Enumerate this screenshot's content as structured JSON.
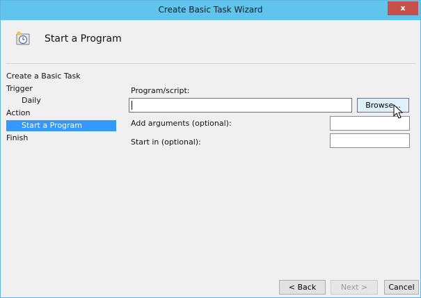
{
  "window": {
    "title": "Create Basic Task Wizard",
    "close_glyph": "x"
  },
  "header": {
    "title": "Start a Program",
    "icon": "task-scheduler-icon"
  },
  "nav": {
    "items": [
      {
        "label": "Create a Basic Task",
        "sub": false,
        "active": false
      },
      {
        "label": "Trigger",
        "sub": false,
        "active": false
      },
      {
        "label": "Daily",
        "sub": true,
        "active": false
      },
      {
        "label": "Action",
        "sub": false,
        "active": false
      },
      {
        "label": "Start a Program",
        "sub": true,
        "active": true
      },
      {
        "label": "Finish",
        "sub": false,
        "active": false
      }
    ]
  },
  "form": {
    "program_label": "Program/script:",
    "program_value": "",
    "browse_label": "Browse...",
    "args_label": "Add arguments (optional):",
    "args_value": "",
    "startin_label": "Start in (optional):",
    "startin_value": ""
  },
  "footer": {
    "back_label": "< Back",
    "next_label": "Next >",
    "cancel_label": "Cancel"
  },
  "colors": {
    "titlebar": "#60c4ed",
    "close": "#c7504a",
    "selection": "#3399ff"
  }
}
